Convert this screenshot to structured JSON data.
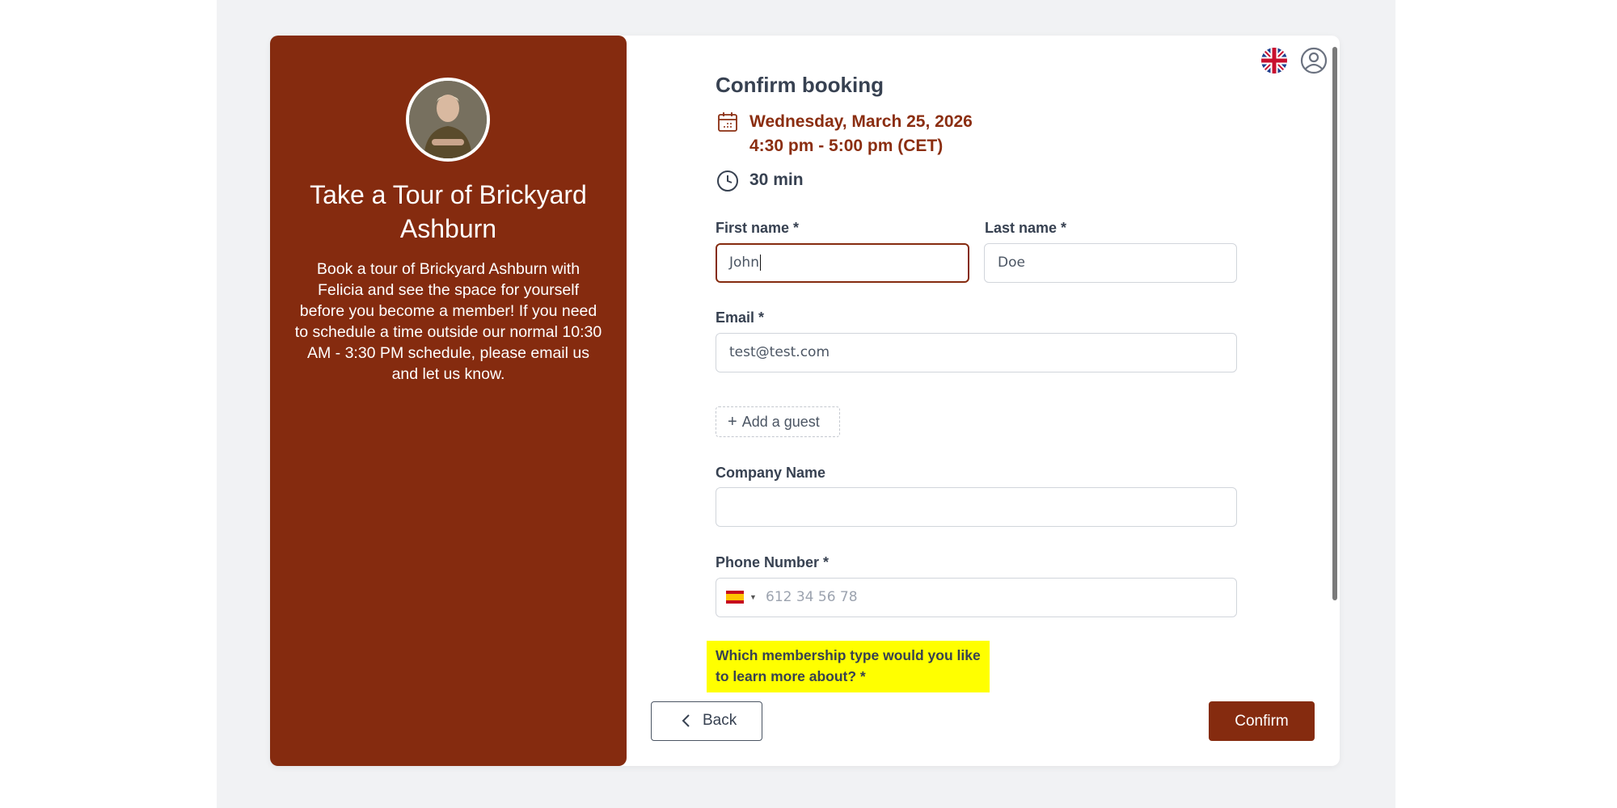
{
  "event": {
    "title": "Take a Tour of Brickyard Ashburn",
    "description": "Book a tour of Brickyard Ashburn with Felicia and see the space for yourself before you become a member! If you need to schedule a time outside our normal 10:30 AM - 3:30 PM schedule, please email us and let us know."
  },
  "header": {
    "language_icon": "uk-flag-icon",
    "user_icon": "user-circle-icon"
  },
  "booking": {
    "heading": "Confirm booking",
    "date": "Wednesday, March 25, 2026",
    "time": "4:30 pm - 5:00 pm (CET)",
    "duration": "30 min"
  },
  "form": {
    "first_name_label": "First name *",
    "first_name_value": "John",
    "last_name_label": "Last name *",
    "last_name_value": "Doe",
    "email_label": "Email *",
    "email_value": "test@test.com",
    "add_guest_label": "Add a guest",
    "company_label": "Company Name",
    "company_value": "",
    "phone_label": "Phone Number *",
    "phone_placeholder": "612 34 56 78",
    "phone_country": "es-flag-icon",
    "membership_question": "Which membership type would you like to learn more about? *"
  },
  "actions": {
    "back_label": "Back",
    "confirm_label": "Confirm"
  },
  "colors": {
    "brand": "#852b0f",
    "highlight": "#ffff00"
  }
}
